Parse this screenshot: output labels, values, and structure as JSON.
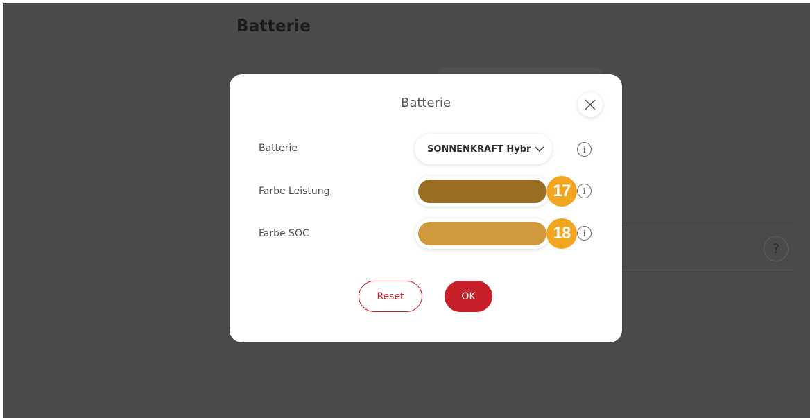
{
  "background": {
    "page_title": "Batterie",
    "help_label": "?"
  },
  "dialog": {
    "title": "Batterie",
    "rows": [
      {
        "label": "Batterie",
        "value": "SONNENKRAFT Hybrid"
      },
      {
        "label": "Farbe Leistung",
        "color": "#9a6e22"
      },
      {
        "label": "Farbe SOC",
        "color": "#cf993c"
      }
    ],
    "badges": [
      "17",
      "18"
    ],
    "info_symbol": "i",
    "buttons": {
      "reset": "Reset",
      "ok": "OK"
    }
  },
  "colors": {
    "accent": "#c8202a",
    "badge": "#f2a520",
    "overlay": "#4a4a4a"
  },
  "icons": [
    "close-icon",
    "chevron-down-icon",
    "info-icon",
    "help-icon"
  ]
}
